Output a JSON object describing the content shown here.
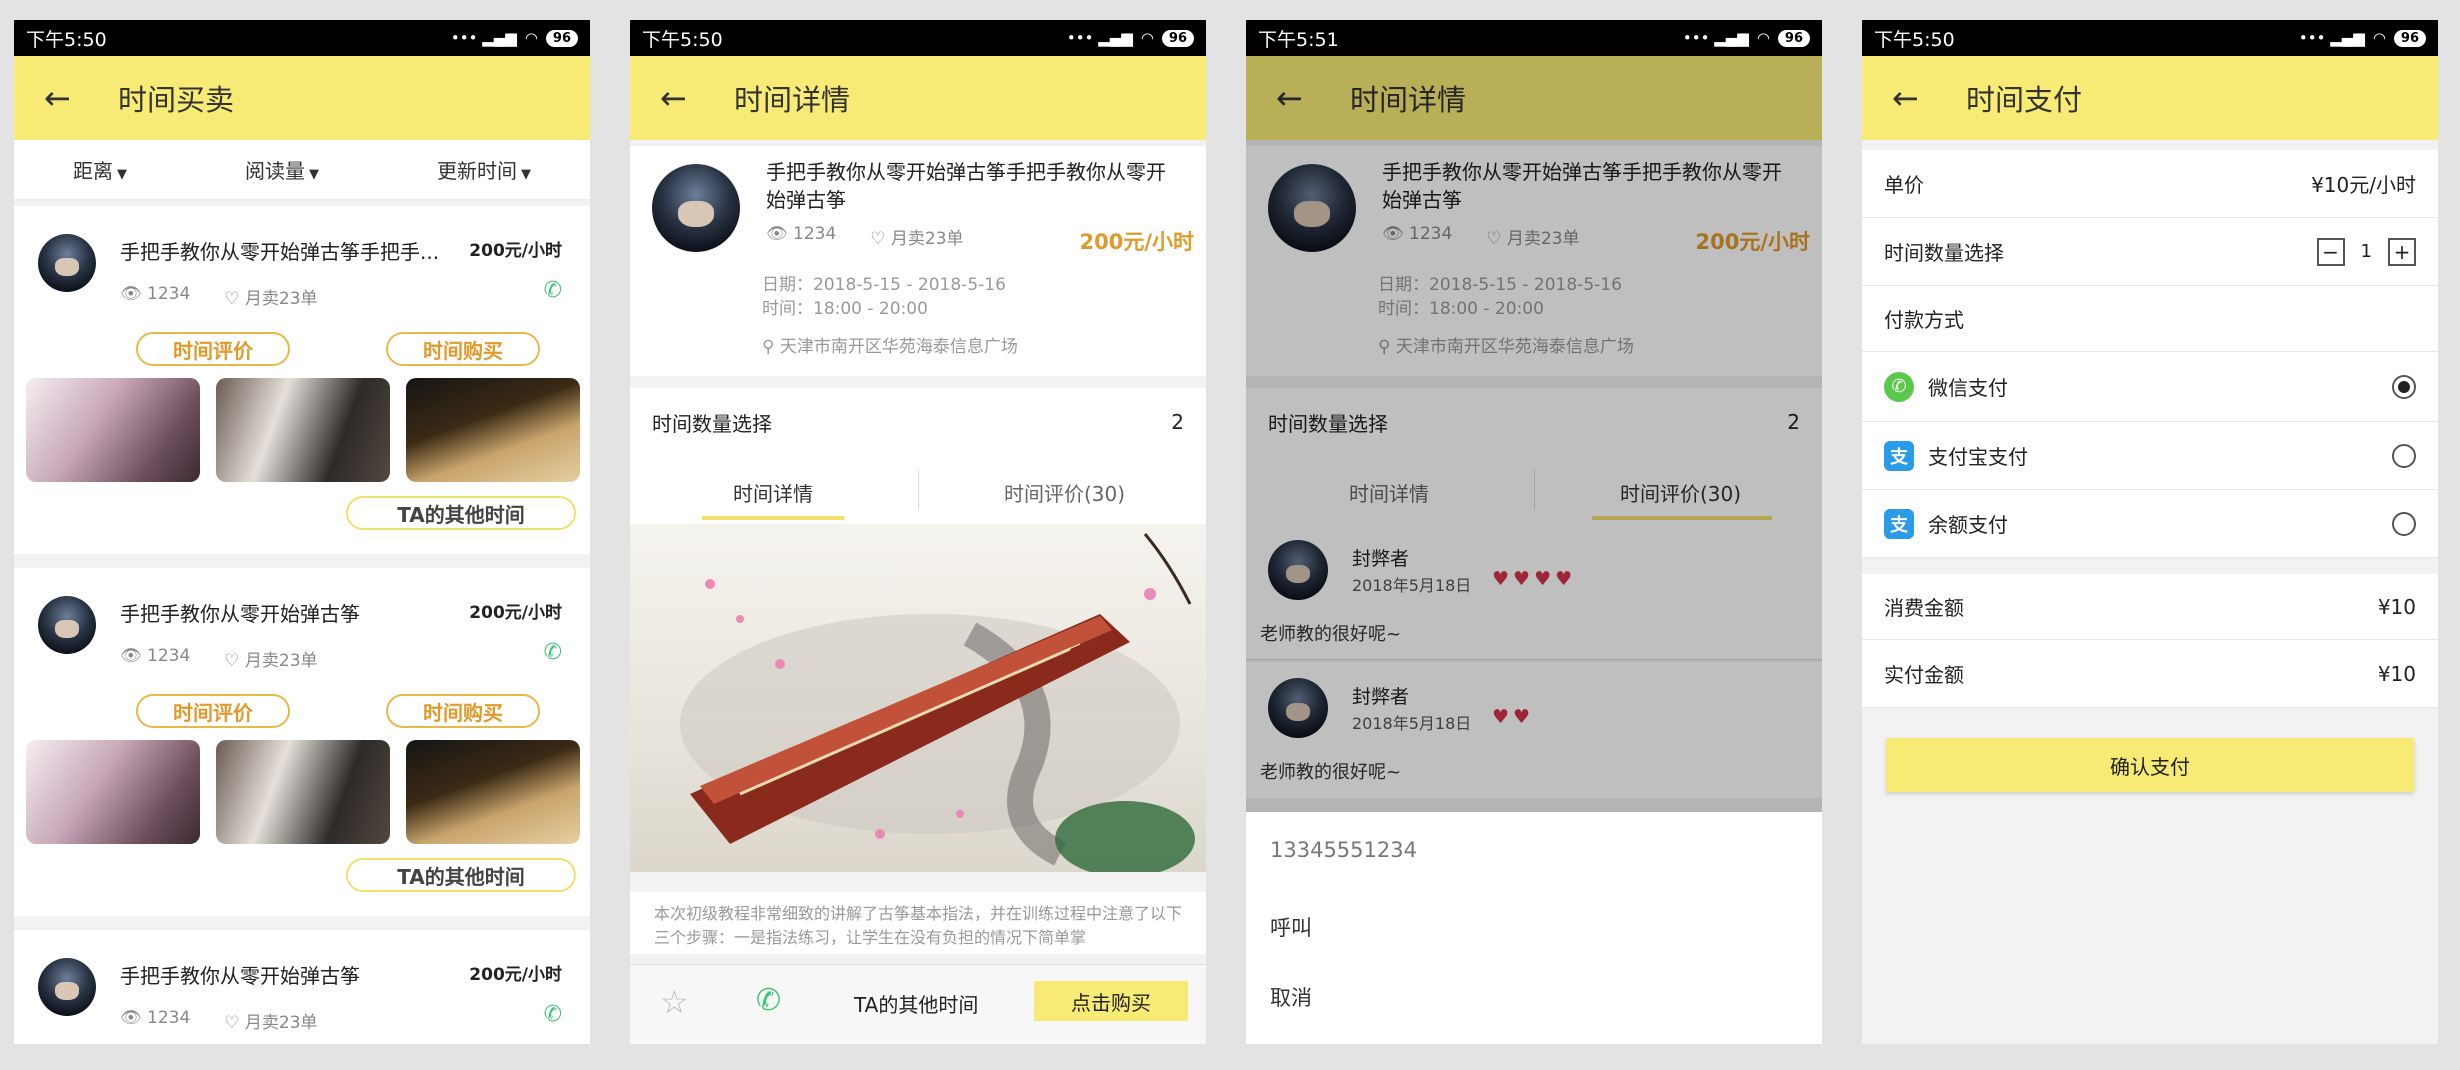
{
  "screen1": {
    "time": "下午5:50",
    "battery": "96",
    "title": "时间买卖",
    "filters": [
      "距离",
      "阅读量",
      "更新时间"
    ],
    "cards": [
      {
        "title": "手把手教你从零开始弹古筝手把手...",
        "price": "200元/小时",
        "views": "1234",
        "sales": "月卖23单",
        "review_btn": "时间评价",
        "buy_btn": "时间购买",
        "other_btn": "TA的其他时间"
      },
      {
        "title": "手把手教你从零开始弹古筝",
        "price": "200元/小时",
        "views": "1234",
        "sales": "月卖23单",
        "review_btn": "时间评价",
        "buy_btn": "时间购买",
        "other_btn": "TA的其他时间"
      },
      {
        "title": "手把手教你从零开始弹古筝",
        "price": "200元/小时",
        "views": "1234",
        "sales": "月卖23单"
      }
    ]
  },
  "screen2": {
    "time": "下午5:50",
    "battery": "96",
    "title": "时间详情",
    "item_title": "手把手教你从零开始弹古筝手把手教你从零开始弹古筝",
    "views": "1234",
    "sales": "月卖23单",
    "price": "200元/小时",
    "date": "日期：2018-5-15 - 2018-5-16",
    "hours": "时间：18:00 - 20:00",
    "location": "天津市南开区华苑海泰信息广场",
    "qty_label": "时间数量选择",
    "qty_value": "2",
    "tab_detail": "时间详情",
    "tab_review": "时间评价(30)",
    "description": "本次初级教程非常细致的讲解了古筝基本指法，并在训练过程中注意了以下三个步骤：一是指法练习，让学生在没有负担的情况下简单掌",
    "bottom_other": "TA的其他时间",
    "bottom_buy": "点击购买"
  },
  "screen3": {
    "time": "下午5:51",
    "battery": "96",
    "title": "时间详情",
    "item_title": "手把手教你从零开始弹古筝手把手教你从零开始弹古筝",
    "views": "1234",
    "sales": "月卖23单",
    "price": "200元/小时",
    "date": "日期：2018-5-15 - 2018-5-16",
    "hours": "时间：18:00 - 20:00",
    "location": "天津市南开区华苑海泰信息广场",
    "qty_label": "时间数量选择",
    "qty_value": "2",
    "tab_detail": "时间详情",
    "tab_review": "时间评价(30)",
    "reviews": [
      {
        "name": "封弊者",
        "date": "2018年5月18日",
        "rating": 4,
        "hearts": "♥♥♥♥",
        "text": "老师教的很好呢~"
      },
      {
        "name": "封弊者",
        "date": "2018年5月18日",
        "rating": 2,
        "hearts": "♥♥",
        "text": "老师教的很好呢~"
      }
    ],
    "sheet_phone": "13345551234",
    "sheet_call": "呼叫",
    "sheet_cancel": "取消"
  },
  "screen4": {
    "time": "下午5:50",
    "battery": "96",
    "title": "时间支付",
    "unit_label": "单价",
    "unit_value": "¥10元/小时",
    "qty_label": "时间数量选择",
    "qty_value": "1",
    "pay_method_label": "付款方式",
    "methods": [
      {
        "label": "微信支付",
        "icon": "wechat-icon",
        "icon_glyph": "✆",
        "color": "#5ac84a",
        "selected": true
      },
      {
        "label": "支付宝支付",
        "icon": "alipay-icon",
        "icon_glyph": "支",
        "color": "#2a9be8",
        "selected": false
      },
      {
        "label": "余额支付",
        "icon": "balance-icon",
        "icon_glyph": "支",
        "color": "#2a9be8",
        "selected": false
      }
    ],
    "consume_label": "消费金额",
    "consume_value": "¥10",
    "paid_label": "实付金额",
    "paid_value": "¥10",
    "confirm": "确认支付"
  },
  "colors": {
    "accent": "#f7ea75",
    "price": "#e19a2a",
    "phone_green": "#3fc67a",
    "heart": "#d2324a"
  }
}
